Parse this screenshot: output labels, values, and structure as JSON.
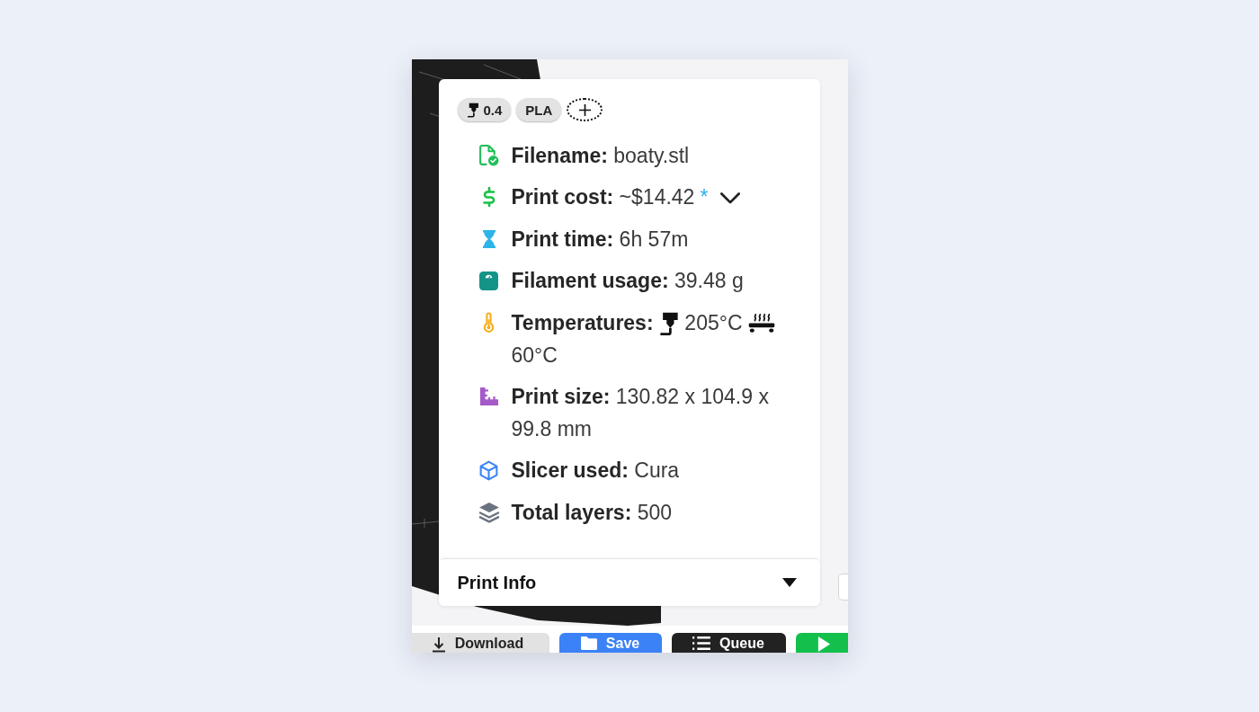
{
  "badges": [
    {
      "kind": "nozzle",
      "label": "0.4"
    },
    {
      "kind": "material",
      "label": "PLA"
    }
  ],
  "details": [
    {
      "kind": "file",
      "label": "Filename:",
      "value": "boaty.stl"
    },
    {
      "kind": "cost",
      "label": "Print cost:",
      "value": "~$14.42",
      "note": "*"
    },
    {
      "kind": "time",
      "label": "Print time:",
      "value": "6h 57m"
    },
    {
      "kind": "weight",
      "label": "Filament usage:",
      "value": "39.48 g"
    },
    {
      "kind": "temperatures",
      "label": "Temperatures:",
      "nozzle": "205°C",
      "bed": "60°C"
    },
    {
      "kind": "size",
      "label": "Print size:",
      "value": "130.82 x 104.9 x 99.8 mm"
    },
    {
      "kind": "slicer",
      "label": "Slicer used:",
      "value": "Cura"
    },
    {
      "kind": "layers",
      "label": "Total layers:",
      "value": "500"
    }
  ],
  "panel": {
    "title": "Print Info"
  },
  "actions": [
    {
      "kind": "download",
      "label": "Download"
    },
    {
      "kind": "save",
      "label": "Save"
    },
    {
      "kind": "queue",
      "label": "Queue"
    },
    {
      "kind": "print"
    }
  ]
}
